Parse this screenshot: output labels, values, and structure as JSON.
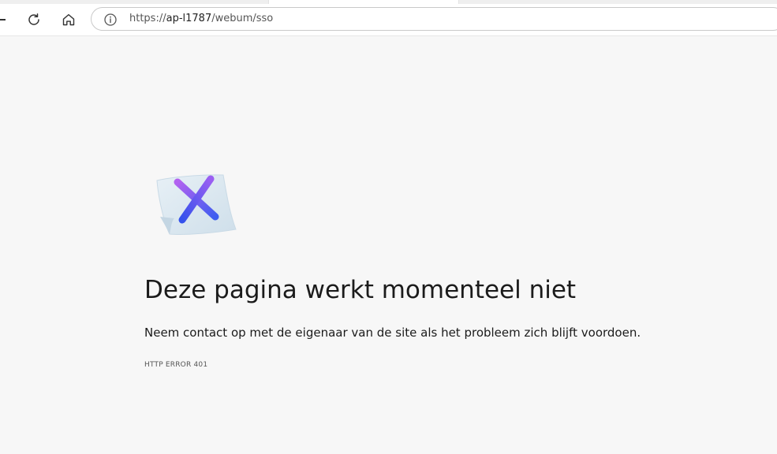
{
  "browser": {
    "address_bar": {
      "scheme": "https://",
      "host": "ap-l1787",
      "path": "/webum/sso"
    }
  },
  "error_page": {
    "headline": "Deze pagina werkt momenteel niet",
    "message": "Neem contact op met de eigenaar van de site als het probleem zich blijft voordoen.",
    "error_code": "HTTP ERROR 401"
  },
  "icons": {
    "refresh": "refresh-icon",
    "home": "home-icon",
    "site_info": "info-icon",
    "illustration": "error-x-illustration"
  },
  "colors": {
    "page_background": "#f7f7f7",
    "x_gradient_start": "#a85ef0",
    "x_gradient_end": "#3a5cf0",
    "paper": "#dfeaf2"
  }
}
